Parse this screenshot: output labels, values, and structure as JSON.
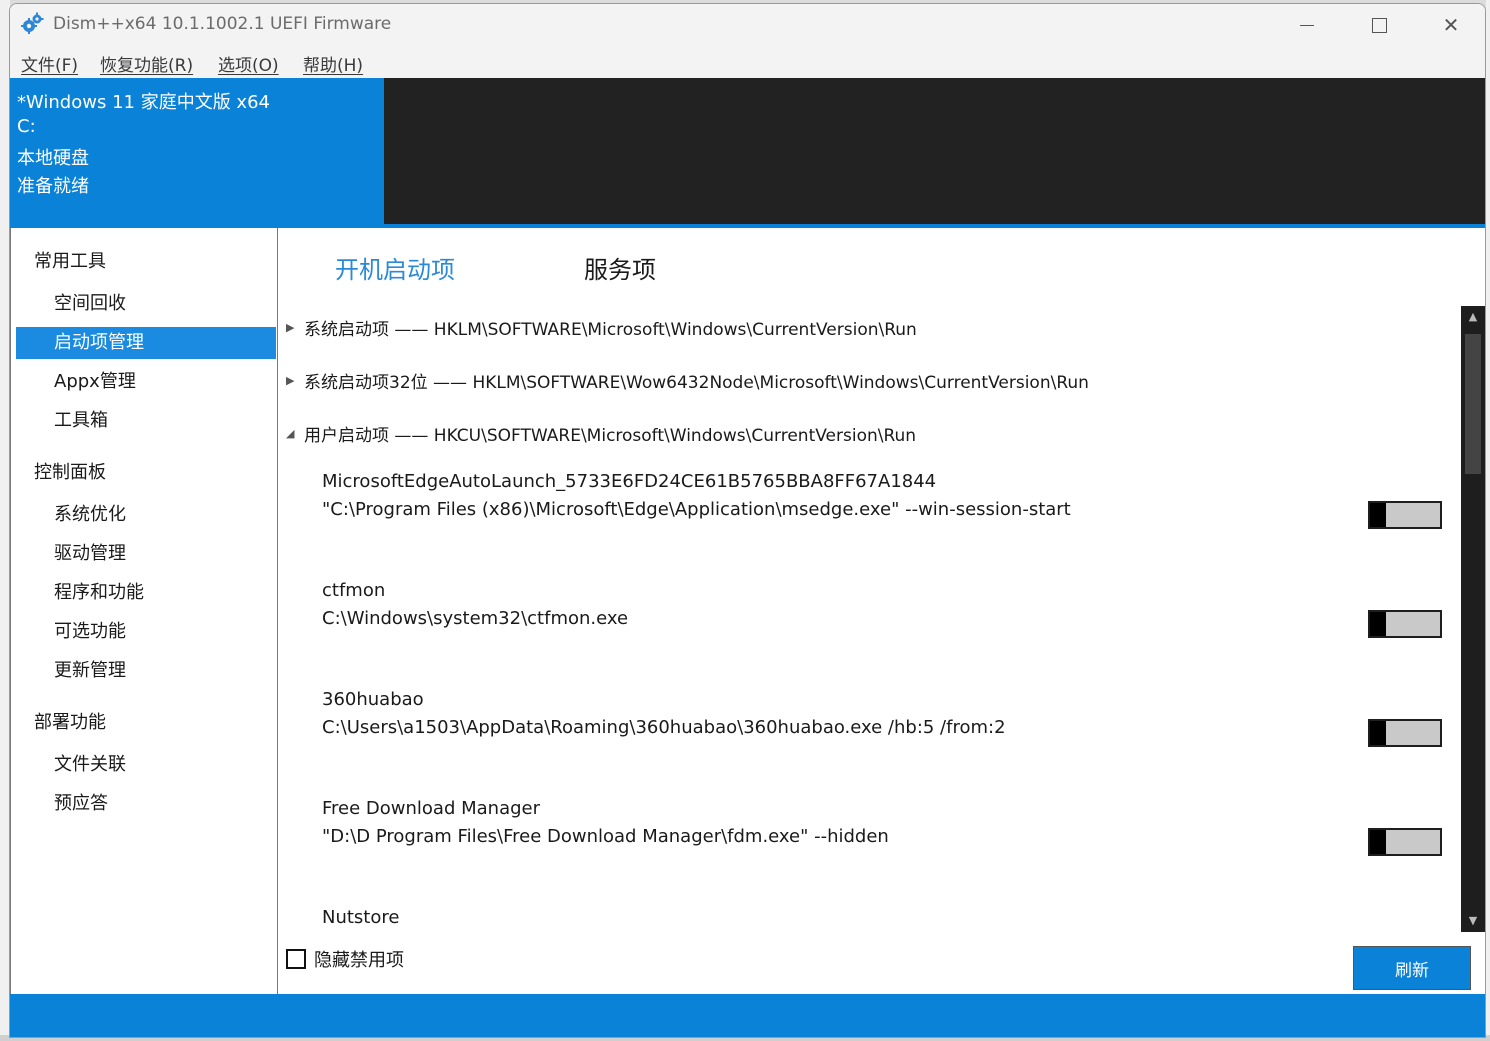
{
  "window": {
    "title": "Dism++x64 10.1.1002.1 UEFI Firmware",
    "app_icon": "gears-icon"
  },
  "menubar": [
    {
      "label": "文件(F)"
    },
    {
      "label": "恢复功能(R)"
    },
    {
      "label": "选项(O)"
    },
    {
      "label": "帮助(H)"
    }
  ],
  "header": {
    "os_name": "*Windows 11 家庭中文版 x64",
    "drive": "C:",
    "disk_type": "本地硬盘",
    "status": "准备就绪",
    "accent_color": "#0a82d8"
  },
  "sidebar": {
    "groups": [
      {
        "label": "常用工具",
        "items": [
          "空间回收",
          "启动项管理",
          "Appx管理",
          "工具箱"
        ]
      },
      {
        "label": "控制面板",
        "items": [
          "系统优化",
          "驱动管理",
          "程序和功能",
          "可选功能",
          "更新管理"
        ]
      },
      {
        "label": "部署功能",
        "items": [
          "文件关联",
          "预应答"
        ]
      }
    ],
    "active_item": "启动项管理"
  },
  "tabs": [
    {
      "label": "开机启动项",
      "active": true
    },
    {
      "label": "服务项",
      "active": false
    }
  ],
  "startup_groups": [
    {
      "label": "系统启动项 —— HKLM\\SOFTWARE\\Microsoft\\Windows\\CurrentVersion\\Run",
      "expanded": false
    },
    {
      "label": "系统启动项32位 —— HKLM\\SOFTWARE\\Wow6432Node\\Microsoft\\Windows\\CurrentVersion\\Run",
      "expanded": false
    },
    {
      "label": "用户启动项 —— HKCU\\SOFTWARE\\Microsoft\\Windows\\CurrentVersion\\Run",
      "expanded": true
    }
  ],
  "entries": [
    {
      "name": "MicrosoftEdgeAutoLaunch_5733E6FD24CE61B5765BBA8FF67A1844",
      "path": "\"C:\\Program Files (x86)\\Microsoft\\Edge\\Application\\msedge.exe\" --win-session-start",
      "enabled": false
    },
    {
      "name": "ctfmon",
      "path": "C:\\Windows\\system32\\ctfmon.exe",
      "enabled": false
    },
    {
      "name": "360huabao",
      "path": "C:\\Users\\a1503\\AppData\\Roaming\\360huabao\\360huabao.exe /hb:5 /from:2",
      "enabled": false
    },
    {
      "name": "Free Download Manager",
      "path": "\"D:\\D Program Files\\Free Download Manager\\fdm.exe\" --hidden",
      "enabled": false
    },
    {
      "name": "Nutstore",
      "path": "",
      "enabled": false
    }
  ],
  "footer": {
    "hide_disabled_label": "隐藏禁用项",
    "hide_disabled_checked": false,
    "refresh_label": "刷新"
  }
}
